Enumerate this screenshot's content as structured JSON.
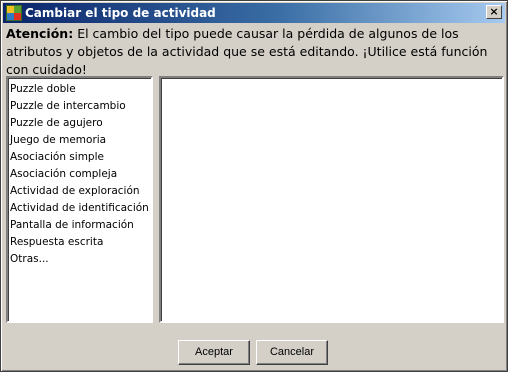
{
  "window": {
    "title": "Cambiar el tipo de actividad",
    "close_label": "×"
  },
  "warning": {
    "label": "Atención:",
    "text": " El cambio del tipo puede causar la pérdida de algunos de los atributos y objetos de la actividad que se está editando. ¡Utilice está función con cuidado!"
  },
  "activity_types": [
    "Puzzle doble",
    "Puzzle de intercambio",
    "Puzzle de agujero",
    "Juego de memoria",
    "Asociación simple",
    "Asociación compleja",
    "Actividad de exploración",
    "Actividad de identificación",
    "Pantalla de información",
    "Respuesta escrita",
    "Otras..."
  ],
  "buttons": {
    "accept": "Aceptar",
    "cancel": "Cancelar"
  },
  "colors": {
    "titlebar_start": "#0a246a",
    "titlebar_end": "#a6caf0",
    "dialog_bg": "#d4d0c8"
  }
}
